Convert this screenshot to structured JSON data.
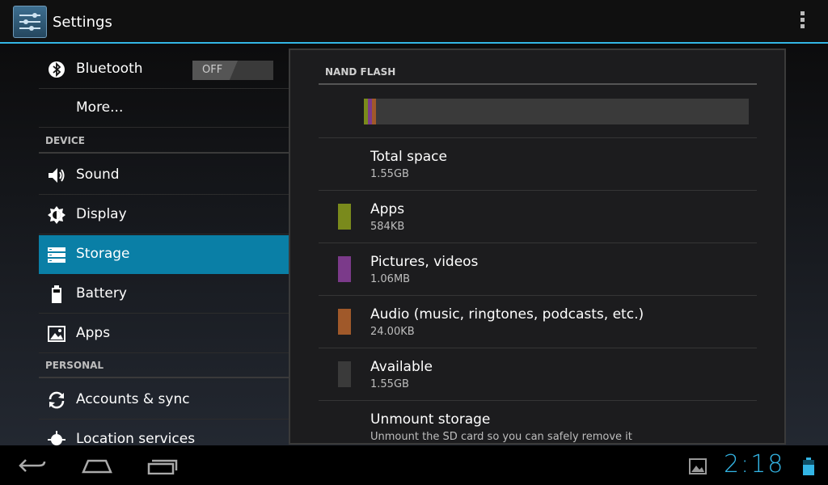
{
  "actionbar": {
    "title": "Settings",
    "icon": "settings-sliders-icon",
    "menu_icon": "overflow-menu-icon"
  },
  "sidebar": {
    "items": [
      {
        "type": "item",
        "label": "Bluetooth",
        "icon": "bluetooth-icon",
        "toggle": "OFF"
      },
      {
        "type": "item",
        "label": "More..."
      },
      {
        "type": "header",
        "label": "DEVICE"
      },
      {
        "type": "item",
        "label": "Sound",
        "icon": "speaker-icon"
      },
      {
        "type": "item",
        "label": "Display",
        "icon": "brightness-icon"
      },
      {
        "type": "item",
        "label": "Storage",
        "icon": "storage-icon",
        "selected": true
      },
      {
        "type": "item",
        "label": "Battery",
        "icon": "battery-icon"
      },
      {
        "type": "item",
        "label": "Apps",
        "icon": "apps-icon"
      },
      {
        "type": "header",
        "label": "PERSONAL"
      },
      {
        "type": "item",
        "label": "Accounts & sync",
        "icon": "sync-icon"
      },
      {
        "type": "item",
        "label": "Location services",
        "icon": "location-icon"
      }
    ]
  },
  "storage": {
    "title": "NAND FLASH",
    "usage_fill": {
      "apps": 0.0037,
      "pictures": 0.0067,
      "audio": 0.0015
    },
    "items": [
      {
        "name": "Total space",
        "value": "1.55GB",
        "color": null
      },
      {
        "name": "Apps",
        "value": "584KB",
        "color": "#7a8a1c"
      },
      {
        "name": "Pictures, videos",
        "value": "1.06MB",
        "color": "#7b3a8a"
      },
      {
        "name": "Audio (music, ringtones, podcasts, etc.)",
        "value": "24.00KB",
        "color": "#a0592a"
      },
      {
        "name": "Available",
        "value": "1.55GB",
        "color": "#3a3a3a"
      },
      {
        "name": "Unmount storage",
        "value": "Unmount the SD card so you can safely remove it",
        "color": null
      }
    ]
  },
  "navbar": {
    "back_icon": "back-icon",
    "home_icon": "home-icon",
    "recents_icon": "recent-apps-icon",
    "gallery_icon": "gallery-notification-icon",
    "time": "2:18",
    "battery_icon": "battery-status-icon"
  }
}
